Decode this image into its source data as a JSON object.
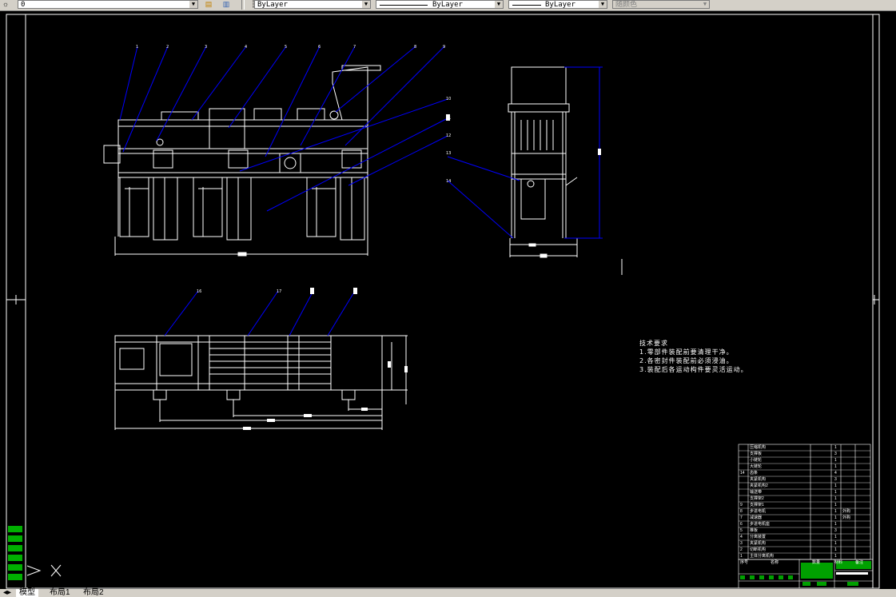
{
  "toolbar": {
    "layer_value": "0",
    "color_value": "ByLayer",
    "linetype_value": "ByLayer",
    "lineweight_value": "ByLayer",
    "plotstyle_value": "随颜色"
  },
  "tabs": [
    {
      "label": "模型"
    },
    {
      "label": "布局1"
    },
    {
      "label": "布局2"
    }
  ],
  "drawing": {
    "balloons_front": [
      "1",
      "2",
      "3",
      "4",
      "5",
      "6",
      "7",
      "8",
      "9",
      "10",
      "11",
      "12",
      "13",
      "14"
    ],
    "balloons_plan": [
      "16",
      "17"
    ],
    "tech_title": "技术要求",
    "tech_notes": [
      "1.零部件装配前要清理干净。",
      "2.各密封件装配前必须浸油。",
      "3.装配后各运动构件要灵活运动。"
    ],
    "bom": [
      {
        "no": "",
        "name": "压缩机构",
        "qty": "1"
      },
      {
        "no": "",
        "name": "支撑板",
        "qty": "3"
      },
      {
        "no": "",
        "name": "小链轮",
        "qty": "1"
      },
      {
        "no": "",
        "name": "大链轮",
        "qty": "1"
      },
      {
        "no": "14",
        "name": "齿条",
        "qty": "4"
      },
      {
        "no": "",
        "name": "夹紧机构",
        "qty": "3"
      },
      {
        "no": "",
        "name": "夹紧机构2",
        "qty": "1"
      },
      {
        "no": "",
        "name": "输送带",
        "qty": "1"
      },
      {
        "no": "",
        "name": "支撑架2",
        "qty": "1"
      },
      {
        "no": "9",
        "name": "支撑架1",
        "qty": "1"
      },
      {
        "no": "8",
        "name": "步进电机",
        "qty": "1",
        "note": "外购"
      },
      {
        "no": "7",
        "name": "减速器",
        "qty": "1",
        "note": "外购"
      },
      {
        "no": "6",
        "name": "步进电机座",
        "qty": "1"
      },
      {
        "no": "5",
        "name": "推板",
        "qty": "3"
      },
      {
        "no": "4",
        "name": "分离装置",
        "qty": "1"
      },
      {
        "no": "3",
        "name": "夹紧机构",
        "qty": "1"
      },
      {
        "no": "2",
        "name": "切断机构",
        "qty": "1"
      },
      {
        "no": "1",
        "name": "主体分离机构",
        "qty": "1"
      }
    ],
    "bom_header": {
      "no": "序号",
      "name": "名称",
      "qty": "数量",
      "material": "材料",
      "note": "备注"
    }
  },
  "colors": {
    "canvas": "#000000",
    "geometry": "#ffffff",
    "leader": "#0000ff",
    "title_block_fill": "#00a000"
  }
}
